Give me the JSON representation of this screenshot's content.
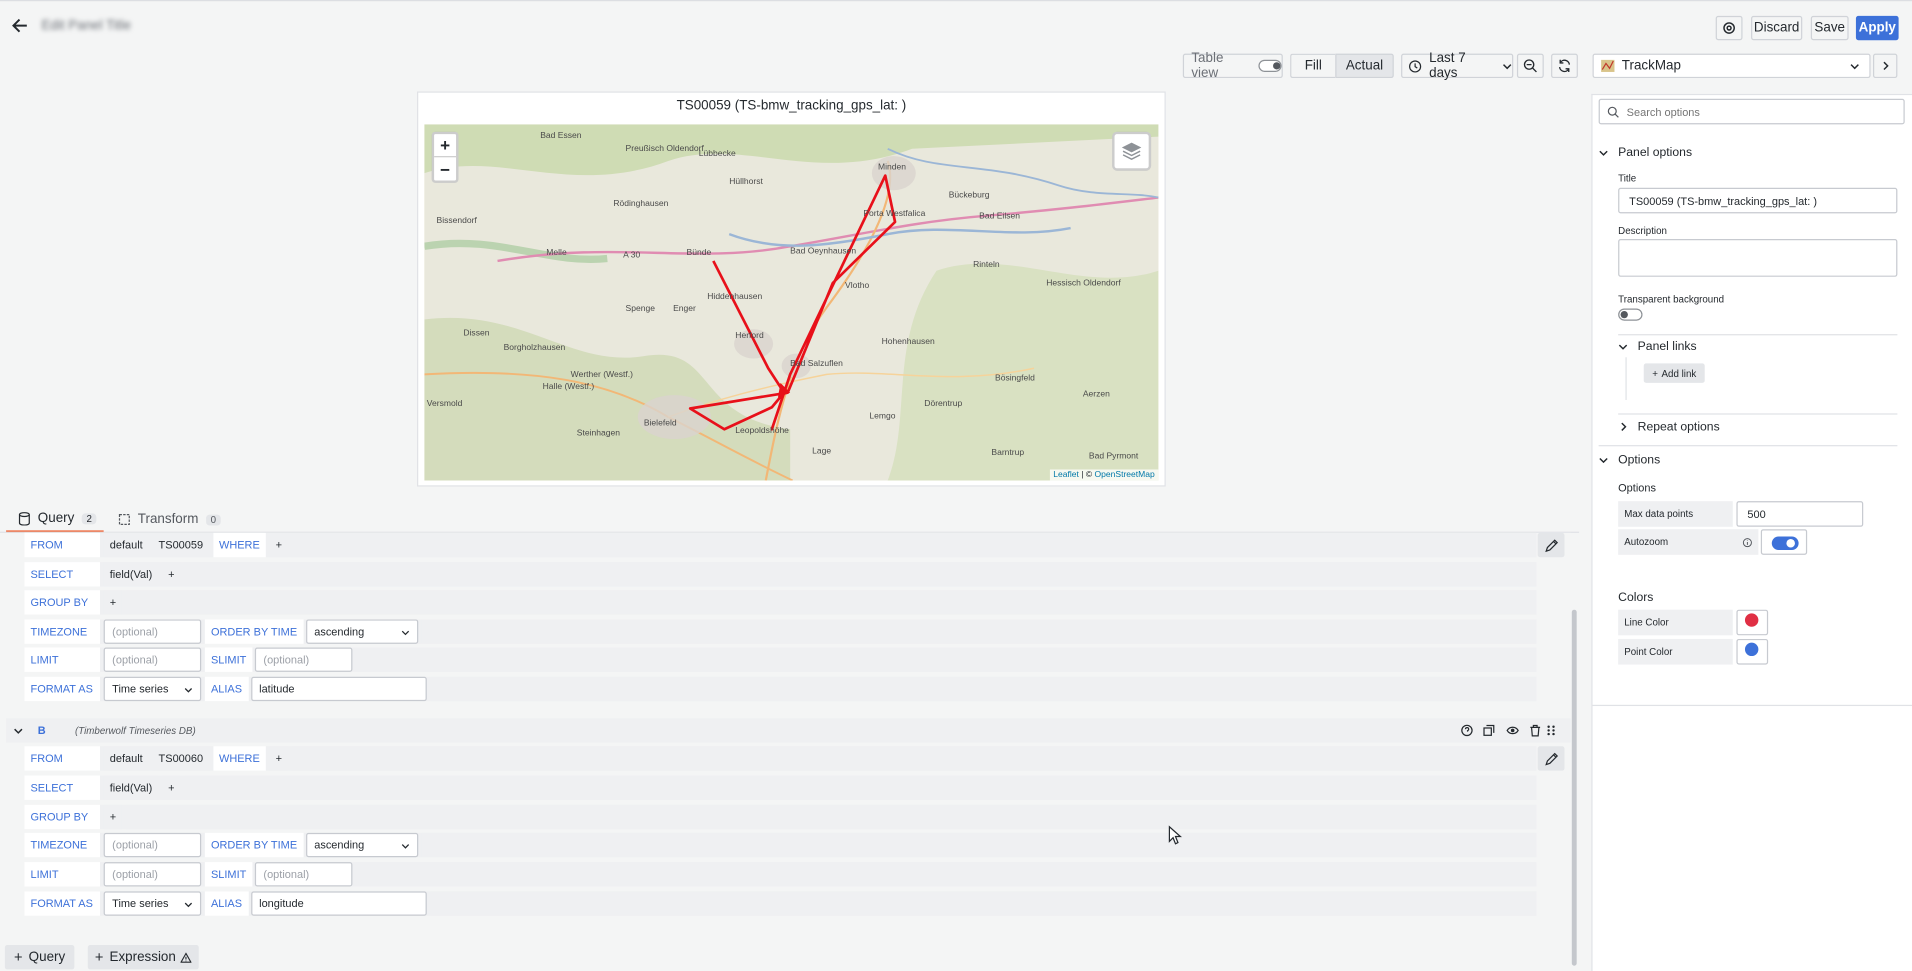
{
  "header": {
    "title": "Edit Panel Title",
    "discard_label": "Discard",
    "save_label": "Save",
    "apply_label": "Apply"
  },
  "toolbar": {
    "table_view_label": "Table view",
    "fill_label": "Fill",
    "actual_label": "Actual",
    "time_range_label": "Last 7 days",
    "visualization_label": "TrackMap"
  },
  "panel": {
    "title": "TS00059 (TS-bmw_tracking_gps_lat: )",
    "attribution_leaflet": "Leaflet",
    "attribution_sep": " | © ",
    "attribution_osm": "OpenStreetMap",
    "zoom_in": "+",
    "zoom_out": "−",
    "map_places": [
      "Bad Essen",
      "Preußisch Oldendorf",
      "Lübbecke",
      "Minden",
      "Bückeburg",
      "Hüllhorst",
      "Porta Westfalica",
      "Bad Eilsen",
      "Rödinghausen",
      "Bissendorf",
      "Melle",
      "Bünde",
      "Bad Oeynhausen",
      "Rinteln",
      "Vlotho",
      "Hiddenhausen",
      "Hessisch Oldendorf",
      "Spenge",
      "Enger",
      "Herford",
      "Dissen",
      "Borgholzhausen",
      "Hohenhausen",
      "Bad Salzuflen",
      "Werther (Westf.)",
      "Halle (Westf.)",
      "Bösingfeld",
      "Versmold",
      "Bielefeld",
      "Lemgo",
      "Dörentrup",
      "Aerzen",
      "Steinhagen",
      "Leopoldshöhe",
      "Lage",
      "Barntrup",
      "Bad Pyrmont",
      "A 30"
    ]
  },
  "tabs": {
    "query_label": "Query",
    "query_count": "2",
    "transform_label": "Transform",
    "transform_count": "0"
  },
  "queryA": {
    "from": "FROM",
    "db": "default",
    "measurement": "TS00059",
    "where": "WHERE",
    "plus": "+",
    "select": "SELECT",
    "field": "field(Val)",
    "group_by": "GROUP BY",
    "timezone": "TIMEZONE",
    "timezone_placeholder": "(optional)",
    "order_by_time": "ORDER BY TIME",
    "order_value": "ascending",
    "limit": "LIMIT",
    "limit_placeholder": "(optional)",
    "slimit": "SLIMIT",
    "slimit_placeholder": "(optional)",
    "format_as": "FORMAT AS",
    "format_value": "Time series",
    "alias": "ALIAS",
    "alias_value": "latitude"
  },
  "queryB": {
    "letter": "B",
    "datasource": "(Timberwolf Timeseries DB)",
    "from": "FROM",
    "db": "default",
    "measurement": "TS00060",
    "where": "WHERE",
    "plus": "+",
    "select": "SELECT",
    "field": "field(Val)",
    "group_by": "GROUP BY",
    "timezone": "TIMEZONE",
    "timezone_placeholder": "(optional)",
    "order_by_time": "ORDER BY TIME",
    "order_value": "ascending",
    "limit": "LIMIT",
    "limit_placeholder": "(optional)",
    "slimit": "SLIMIT",
    "slimit_placeholder": "(optional)",
    "format_as": "FORMAT AS",
    "format_value": "Time series",
    "alias": "ALIAS",
    "alias_value": "longitude"
  },
  "bottom": {
    "add_query_label": "Query",
    "add_expression_label": "Expression"
  },
  "options": {
    "search_placeholder": "Search options",
    "panel_options_label": "Panel options",
    "title_label": "Title",
    "title_value": "TS00059 (TS-bmw_tracking_gps_lat: )",
    "description_label": "Description",
    "transparent_label": "Transparent background",
    "panel_links_label": "Panel links",
    "add_link_label": "Add link",
    "repeat_options_label": "Repeat options",
    "options_section_label": "Options",
    "options_sub_label": "Options",
    "max_data_points_label": "Max data points",
    "max_data_points_value": "500",
    "autozoom_label": "Autozoom",
    "autozoom_on": true,
    "colors_label": "Colors",
    "line_color_label": "Line Color",
    "line_color": "#e02f44",
    "point_color_label": "Point Color",
    "point_color": "#3d71d9"
  }
}
